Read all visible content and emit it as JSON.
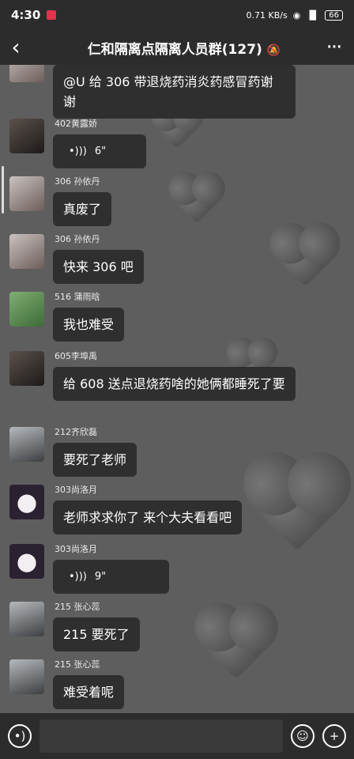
{
  "status": {
    "time": "4:30",
    "speed": "0.71",
    "speed_unit": "KB/s",
    "battery": "66"
  },
  "nav": {
    "back": "‹",
    "title": "仁和隔离点隔离人员群(127)",
    "mute_icon": "🔕",
    "more": "···"
  },
  "messages": [
    {
      "name": "",
      "text": "@U 给 306 带退烧药消炎药感冒药谢谢",
      "type": "text"
    },
    {
      "name": "402黄露娇",
      "duration": "6\"",
      "type": "voice"
    },
    {
      "name": "306 孙依丹",
      "text": "真废了",
      "type": "text"
    },
    {
      "name": "306 孙依丹",
      "text": "快来 306 吧",
      "type": "text"
    },
    {
      "name": "516 蒲雨晗",
      "text": "我也难受",
      "type": "text"
    },
    {
      "name": "605李埠禹",
      "text": "给 608 送点退烧药啥的她俩都睡死了要",
      "type": "text"
    },
    {
      "name": "212齐欣磊",
      "text": "要死了老师",
      "type": "text"
    },
    {
      "name": "303尚洛月",
      "text": "老师求求你了 来个大夫看看吧",
      "type": "text"
    },
    {
      "name": "303尚洛月",
      "duration": "9\"",
      "type": "voice"
    },
    {
      "name": "215 张心蕊",
      "text": "215 要死了",
      "type": "text"
    },
    {
      "name": "215 张心蕊",
      "text": "难受着呢",
      "type": "text"
    }
  ],
  "input": {
    "placeholder": ""
  },
  "colors": {
    "background": "#5e5e5e",
    "bar": "#2c2c2c",
    "bubble": "#2f2f2f"
  }
}
